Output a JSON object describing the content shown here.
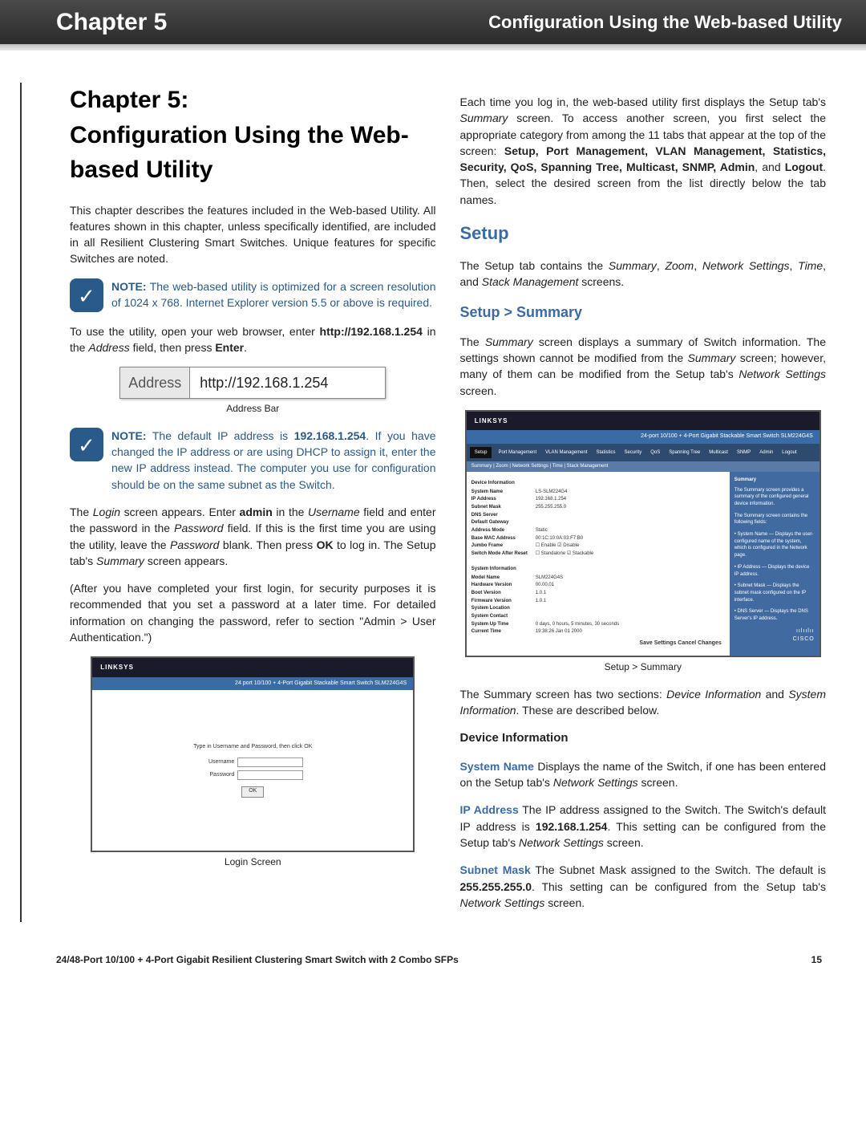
{
  "header": {
    "chapter": "Chapter 5",
    "subtitle": "Configuration Using the Web-based Utility"
  },
  "left": {
    "title": "Chapter 5:\nConfiguration Using the Web-based Utility",
    "intro": "This chapter describes the features included in the Web-based Utility. All features shown in this chapter, unless specifically identified, are included in all Resilient Clustering Smart Switches. Unique features for specific Switches are noted.",
    "note1_label": "NOTE:",
    "note1": " The web-based utility is optimized for a screen resolution of 1024 x 768. Internet Explorer version 5.5 or above is required.",
    "para2_a": "To use the utility, open your web browser, enter ",
    "para2_url": "http://192.168.1.254",
    "para2_b": " in the ",
    "para2_c": "Address",
    "para2_d": " field, then press ",
    "para2_e": "Enter",
    "para2_f": ".",
    "addr_label": "Address",
    "addr_url": "http://192.168.1.254",
    "addr_caption": "Address Bar",
    "note2_label": "NOTE:",
    "note2_a": " The default IP address is ",
    "note2_ip": "192.168.1.254",
    "note2_b": ". If you have changed the IP address or are using DHCP to assign it, enter the new IP address instead. The computer you use for configuration should be on the same subnet as the Switch.",
    "para3_a": "The ",
    "para3_b": "Login",
    "para3_c": " screen appears. Enter ",
    "para3_d": "admin",
    "para3_e": " in the ",
    "para3_f": "Username",
    "para3_g": " field and enter the password in the ",
    "para3_h": "Password",
    "para3_i": " field. If this is the first time you are using the utility, leave the ",
    "para3_j": "Password",
    "para3_k": " blank. Then press ",
    "para3_l": "OK",
    "para3_m": " to log in. The Setup tab's ",
    "para3_n": "Summary",
    "para3_o": " screen appears.",
    "para4": "(After you have completed your first login, for security purposes it is recommended that you set a password at a later time. For detailed information on changing the password, refer to section \"Admin > User Authentication.\")",
    "login_caption": "Login Screen",
    "login_brand": "LINKSYS",
    "login_banner": "24 port 10/100 + 4-Port Gigabit Stackable Smart Switch   SLM224G4S",
    "login_hint": "Type in Username and Password, then click OK",
    "login_user_lbl": "Username",
    "login_pass_lbl": "Password",
    "login_ok": "OK"
  },
  "right": {
    "intro_a": "Each time you log in, the web-based utility first displays the Setup tab's ",
    "intro_b": "Summary",
    "intro_c": " screen. To access another screen, you first select the appropriate category from among the 11 tabs that appear at the top of the screen: ",
    "tabs": "Setup, Port Management, VLAN Management, Statistics, Security, QoS, Spanning Tree, Multicast, SNMP, Admin",
    "intro_d": ", and ",
    "intro_e": "Logout",
    "intro_f": ". Then, select the desired screen from the list directly below the tab names.",
    "h_setup": "Setup",
    "setup_para_a": "The Setup tab contains the ",
    "setup_para_b": "Summary",
    "setup_para_c": ", ",
    "setup_para_d": "Zoom",
    "setup_para_e": ", ",
    "setup_para_f": "Network Settings",
    "setup_para_g": ", ",
    "setup_para_h": "Time",
    "setup_para_i": ", and ",
    "setup_para_j": "Stack Management",
    "setup_para_k": " screens.",
    "h_summary": "Setup > Summary",
    "summary_para_a": "The ",
    "summary_para_b": "Summary",
    "summary_para_c": " screen displays a summary of Switch information. The settings shown cannot be modified from the ",
    "summary_para_d": "Summary",
    "summary_para_e": " screen; however, many of them can be modified from the Setup tab's ",
    "summary_para_f": "Network Settings",
    "summary_para_g": " screen.",
    "shot": {
      "brand": "LINKSYS",
      "banner": "24-port 10/100 + 4-Port Gigabit Stackable Smart Switch   SLM224G4S",
      "tab_active": "Setup",
      "tabs_list": [
        "Setup",
        "Port Management",
        "VLAN Management",
        "Statistics",
        "Security",
        "QoS",
        "Spanning Tree",
        "Multicast",
        "SNMP",
        "Admin",
        "Logout"
      ],
      "subtabs": "Summary | Zoom | Network Settings | Time | Stack Management",
      "sec1": "Device Information",
      "di": [
        {
          "k": "System Name",
          "v": "LS-SLM224G4"
        },
        {
          "k": "IP Address",
          "v": "192.168.1.254"
        },
        {
          "k": "Subnet Mask",
          "v": "255.255.255.0"
        },
        {
          "k": "DNS Server",
          "v": ""
        },
        {
          "k": "Default Gateway",
          "v": ""
        },
        {
          "k": "Address Mode",
          "v": "Static"
        },
        {
          "k": "Base MAC Address",
          "v": "00:1C:10:0A:03:F7:B0"
        },
        {
          "k": "Jumbo Frame",
          "v": "☐ Enable ☑ Disable"
        },
        {
          "k": "Switch Mode After Reset",
          "v": "☐ Standalone ☑ Stackable"
        }
      ],
      "sec2": "System Information",
      "si": [
        {
          "k": "Model Name",
          "v": "SLM224G4S"
        },
        {
          "k": "Hardware Version",
          "v": "00.00.01"
        },
        {
          "k": "Boot Version",
          "v": "1.0.1"
        },
        {
          "k": "Firmware Version",
          "v": "1.0.1"
        },
        {
          "k": "System Location",
          "v": ""
        },
        {
          "k": "System Contact",
          "v": ""
        },
        {
          "k": "System Up Time",
          "v": "0 days, 0 hours, 5 minutes, 30 seconds"
        },
        {
          "k": "Current Time",
          "v": "19:38:26   Jan 01 2000"
        }
      ],
      "save": "Save Settings  Cancel Changes",
      "side_title": "Summary",
      "side_items": [
        "The Summary screen provides a summary of the configured general device information.",
        "The Summary screen contains the following fields:",
        "• System Name — Displays the user-configured name of the system, which is configured in the Network page.",
        "• IP Address — Displays the device IP address.",
        "• Subnet Mask — Displays the subnet mask configured on the IP interface.",
        "• DNS Server — Displays the DNS Server's IP address."
      ],
      "cisco": "ıılıılıı\nCISCO"
    },
    "shot_caption": "Setup > Summary",
    "after_shot_a": "The Summary screen has two sections: ",
    "after_shot_b": "Device Information",
    "after_shot_c": " and ",
    "after_shot_d": "System Information",
    "after_shot_e": ". These are described below.",
    "h_devinfo": "Device Information",
    "sysname_term": "System Name",
    "sysname_text_a": "  Displays the name of the Switch, if one has been entered on the Setup tab's ",
    "sysname_text_b": "Network Settings",
    "sysname_text_c": " screen.",
    "ip_term": "IP Address",
    "ip_text_a": "  The IP address assigned to the Switch. The Switch's default IP address is ",
    "ip_text_b": "192.168.1.254",
    "ip_text_c": ". This setting can be configured from the Setup tab's ",
    "ip_text_d": "Network Settings",
    "ip_text_e": " screen.",
    "mask_term": "Subnet Mask",
    "mask_text_a": "  The Subnet Mask assigned to the Switch. The default is ",
    "mask_text_b": "255.255.255.0",
    "mask_text_c": ". This setting can be configured from the Setup tab's ",
    "mask_text_d": "Network Settings",
    "mask_text_e": " screen."
  },
  "footer": {
    "left": "24/48-Port 10/100 + 4-Port Gigabit Resilient Clustering Smart Switch with 2 Combo SFPs",
    "right": "15"
  }
}
